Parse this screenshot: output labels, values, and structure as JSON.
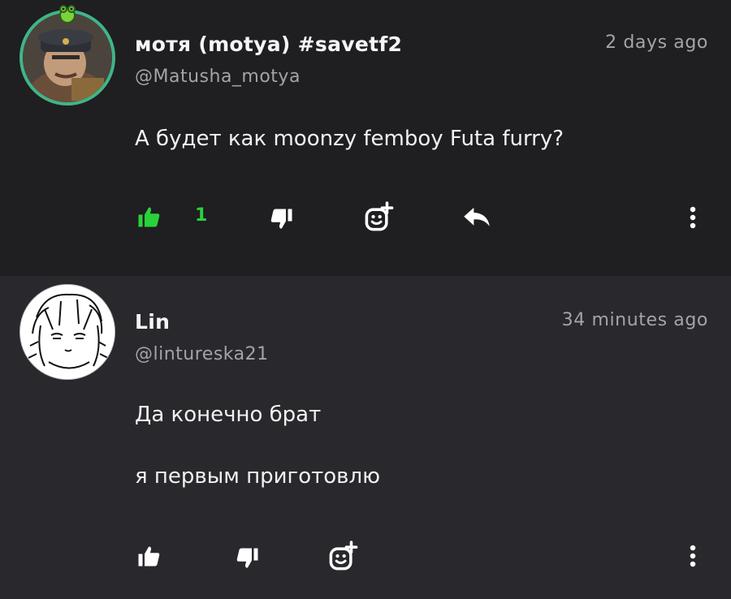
{
  "comments": [
    {
      "author_name": "мотя (motya) #savetf2",
      "handle": "@Matusha_motya",
      "time": "2 days ago",
      "text": [
        "А будет как moonzy femboy Futa furry?"
      ],
      "likes": "1",
      "liked": true,
      "actions": [
        "like-icon",
        "dislike-icon",
        "add-reaction-icon",
        "reply-icon",
        "more-icon"
      ]
    },
    {
      "author_name": "Lin",
      "handle": "@lintureska21",
      "time": "34 minutes ago",
      "text": [
        "Да конечно брат",
        "я первым приготовлю"
      ],
      "likes": "",
      "liked": false,
      "actions": [
        "like-icon",
        "dislike-icon",
        "add-reaction-icon",
        "more-icon"
      ]
    }
  ],
  "colors": {
    "liked": "#28d33a",
    "icon": "#ffffff",
    "muted": "#a4a3a8"
  }
}
